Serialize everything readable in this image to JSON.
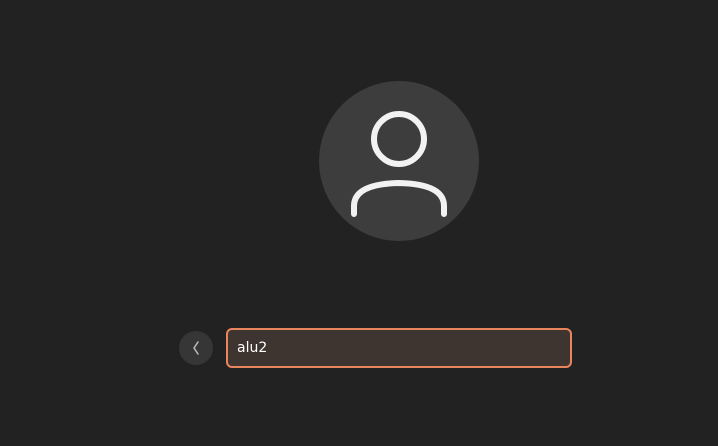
{
  "login": {
    "avatar_icon": "user-silhouette-icon",
    "back_icon": "chevron-left-icon",
    "username_value": "alu2",
    "placeholder": ""
  },
  "colors": {
    "background": "#222222",
    "avatar_bg": "#3d3d3d",
    "field_border": "#e9855c",
    "field_bg": "#3e3430"
  }
}
